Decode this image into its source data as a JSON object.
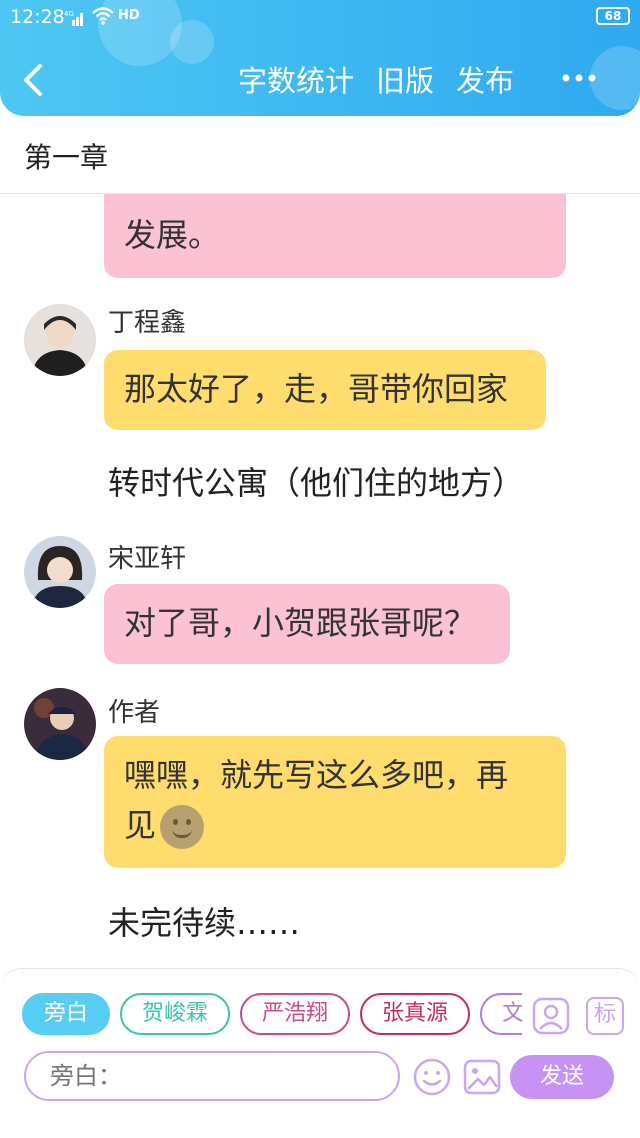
{
  "status_bar": {
    "time": "12:28",
    "signal_tag": "4G",
    "network_tag": "HD",
    "battery": "68"
  },
  "header": {
    "actions": [
      "字数统计",
      "旧版",
      "发布"
    ],
    "more": "•••"
  },
  "chapter": {
    "title": "第一章"
  },
  "chat": {
    "partial_bubble_text": "发展。",
    "messages": [
      {
        "sender": "丁程鑫",
        "text": "那太好了，走，哥带你回家",
        "color": "#ffdc6e"
      },
      {
        "narration": "转时代公寓（他们住的地方）"
      },
      {
        "sender": "宋亚轩",
        "text": "对了哥，小贺跟张哥呢？",
        "color": "#fac2d2"
      },
      {
        "sender": "作者",
        "text_line1": "嘿嘿，就先写这么多吧，再",
        "text_line2": "见",
        "color": "#ffdc6e"
      },
      {
        "narration": "未完待续……"
      }
    ]
  },
  "composer": {
    "roles": [
      "旁白",
      "贺峻霖",
      "严浩翔",
      "张真源",
      "文"
    ],
    "input_placeholder": "旁白：",
    "send_label": "发送",
    "tag_label": "标"
  },
  "colors": {
    "header": "#2fa9f0",
    "pink_bubble": "#fac2d2",
    "yellow_bubble": "#ffdc6e",
    "send": "#c693f5"
  }
}
